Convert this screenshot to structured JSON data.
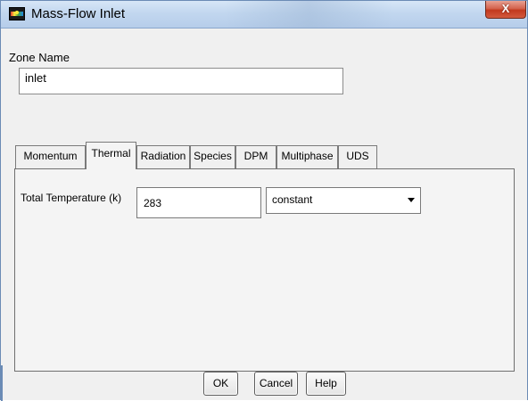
{
  "window": {
    "title": "Mass-Flow Inlet",
    "close_glyph": "X",
    "app_icon": "fluent-app-icon",
    "close_icon": "close-icon"
  },
  "zone": {
    "label": "Zone Name",
    "value": "inlet"
  },
  "tabs": [
    {
      "label": "Momentum",
      "active": false
    },
    {
      "label": "Thermal",
      "active": true
    },
    {
      "label": "Radiation",
      "active": false
    },
    {
      "label": "Species",
      "active": false
    },
    {
      "label": "DPM",
      "active": false
    },
    {
      "label": "Multiphase",
      "active": false
    },
    {
      "label": "UDS",
      "active": false
    }
  ],
  "thermal": {
    "total_temperature_label": "Total Temperature (k)",
    "total_temperature_value": "283",
    "method": "constant",
    "dropdown_icon": "chevron-down-icon"
  },
  "buttons": {
    "ok": "OK",
    "cancel": "Cancel",
    "help": "Help"
  },
  "colors": {
    "title_bar": "#c2d7ef",
    "close_button": "#c2391e",
    "dialog_bg": "#f0f0f0"
  }
}
